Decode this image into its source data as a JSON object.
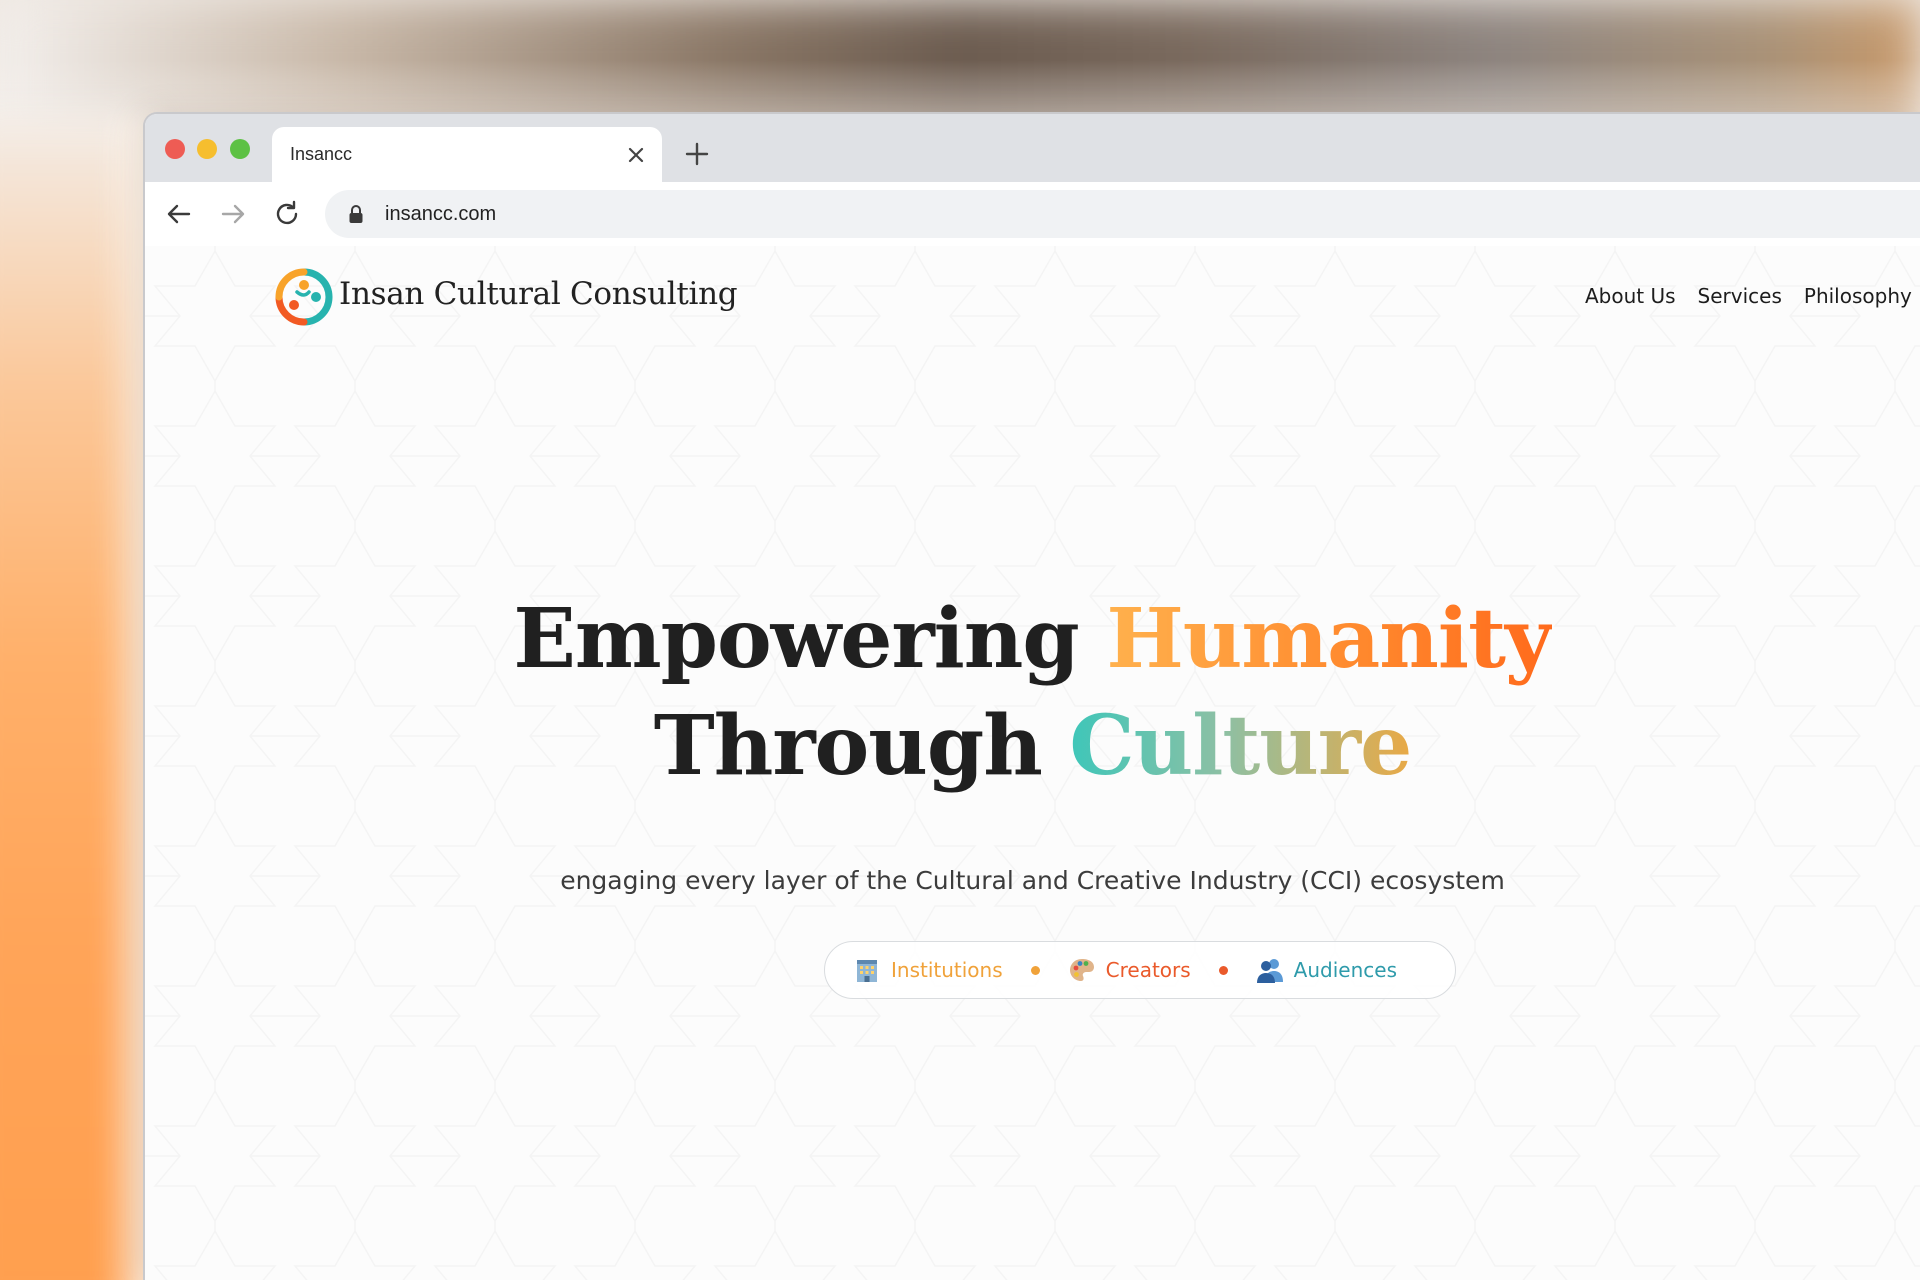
{
  "browser": {
    "tab_title": "Insancc",
    "url": "insancc.com"
  },
  "site": {
    "logo_text": "Insan Cultural Consulting",
    "nav": [
      "About Us",
      "Services",
      "Philosophy"
    ]
  },
  "hero": {
    "line1_prefix": "Empowering ",
    "line1_accent": "Humanity",
    "line2_prefix": "Through ",
    "line2_accent": "Culture",
    "subtitle": "engaging every layer of the Cultural and Creative Industry (CCI) ecosystem"
  },
  "segments": [
    {
      "label": "Institutions",
      "icon": "building-icon",
      "color": "#f0a23a"
    },
    {
      "label": "Creators",
      "icon": "palette-icon",
      "color": "#ea5a2b"
    },
    {
      "label": "Audiences",
      "icon": "people-icon",
      "color": "#2f9bab"
    }
  ],
  "colors": {
    "humanity_gradient": [
      "#ffb14d",
      "#ff6a1c"
    ],
    "culture_gradient": [
      "#3ec6b9",
      "#e9a946"
    ],
    "dot_1": "#f0a23a",
    "dot_2": "#ea5a2b"
  }
}
